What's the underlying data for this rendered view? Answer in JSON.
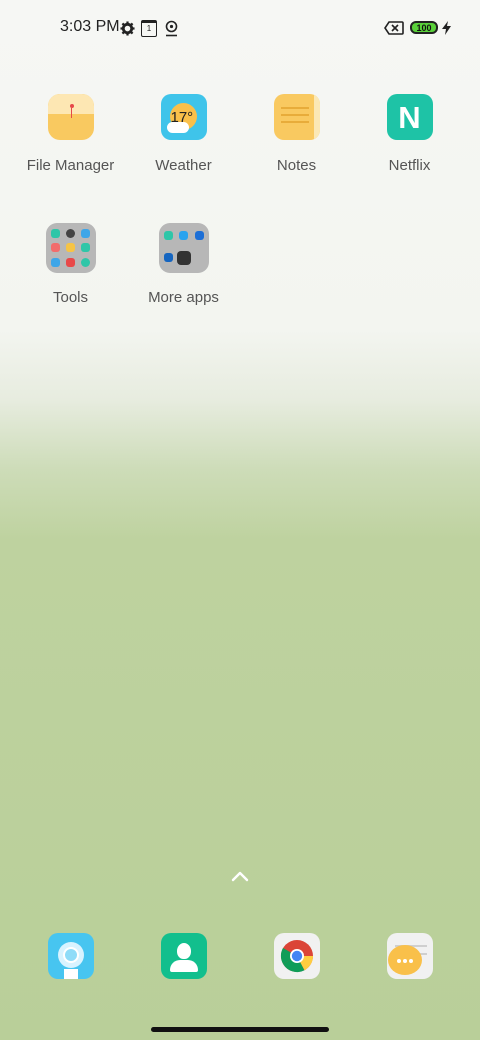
{
  "status_bar": {
    "time": "3:03 PM",
    "icons": [
      "gear-icon",
      "calendar-icon",
      "location-icon",
      "no-sim-icon",
      "charging-icon"
    ],
    "calendar_day": "1",
    "battery_level": "100"
  },
  "home": {
    "apps": [
      {
        "label": "File Manager",
        "icon": "file-manager-icon"
      },
      {
        "label": "Weather",
        "icon": "weather-icon",
        "temp": "17°"
      },
      {
        "label": "Notes",
        "icon": "notes-icon"
      },
      {
        "label": "Netflix",
        "icon": "netflix-icon",
        "letter": "N"
      }
    ],
    "folders": [
      {
        "label": "Tools",
        "icon": "tools-folder-icon"
      },
      {
        "label": "More apps",
        "icon": "more-apps-folder-icon"
      }
    ]
  },
  "dock": {
    "apps": [
      "camera-icon",
      "contacts-icon",
      "chrome-icon",
      "messages-icon"
    ]
  },
  "colors": {
    "accent_teal": "#1ec3a6",
    "weather_blue": "#3fc4ea",
    "note_yellow": "#f9c960",
    "folder_gray": "#b7b7b7",
    "battery_green": "#5ad13a"
  }
}
